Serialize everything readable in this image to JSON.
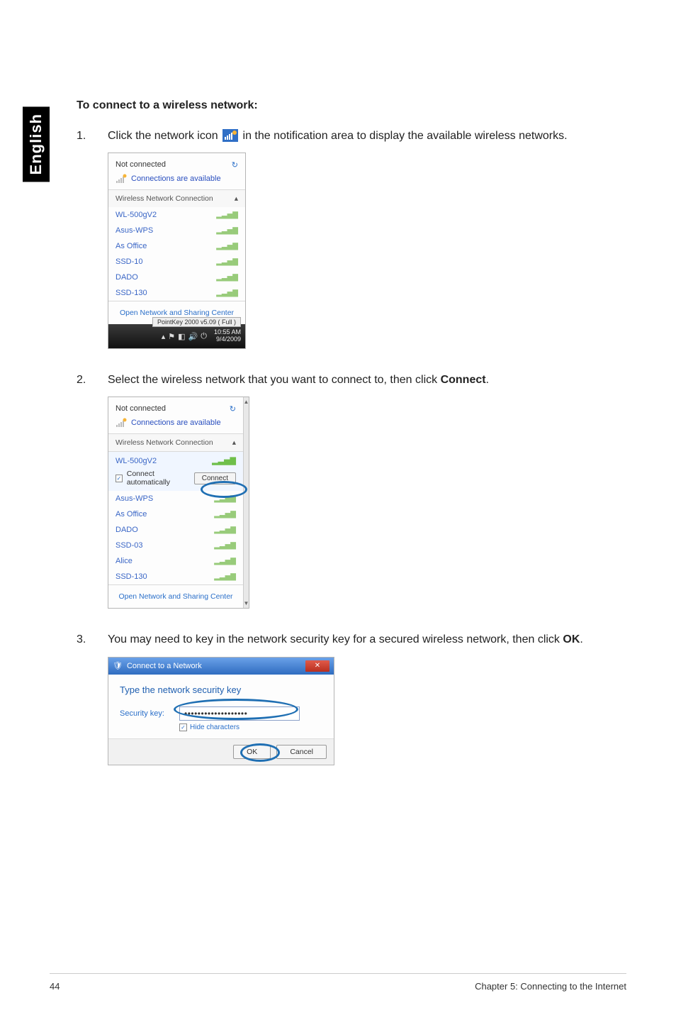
{
  "sidebar_label": "English",
  "heading": "To connect to a wireless network:",
  "steps": {
    "s1": {
      "num": "1.",
      "text_before": "Click the network icon ",
      "text_after": " in the notification area to display the available wireless networks."
    },
    "s2": {
      "num": "2.",
      "text_before": "Select the wireless network that you want to connect to, then click ",
      "bold": "Connect",
      "text_after": "."
    },
    "s3": {
      "num": "3.",
      "text_before": "You may need to key in the network security key for a secured wireless network, then click ",
      "bold": "OK",
      "text_after": "."
    }
  },
  "panel1": {
    "not_connected": "Not connected",
    "conn_available": "Connections are available",
    "section": "Wireless Network Connection",
    "networks": [
      "WL-500gV2",
      "Asus-WPS",
      "As Office",
      "SSD-10",
      "DADO",
      "SSD-130"
    ],
    "footer": "Open Network and Sharing Center",
    "tray_pill": "PointKey 2000 v5.09 ( Full )",
    "time1": "10:55 AM",
    "time2": "9/4/2009"
  },
  "panel2": {
    "not_connected": "Not connected",
    "conn_available": "Connections are available",
    "section": "Wireless Network Connection",
    "selected_ssid": "WL-500gV2",
    "auto_label": "Connect automatically",
    "connect_btn": "Connect",
    "networks": [
      "Asus-WPS",
      "As Office",
      "DADO",
      "SSD-03",
      "Alice",
      "SSD-130"
    ],
    "footer": "Open Network and Sharing Center"
  },
  "panel3": {
    "title": "Connect to a Network",
    "prompt": "Type the network security key",
    "key_label": "Security key:",
    "key_value": "•••••••••••••••••••",
    "hide_chars": "Hide characters",
    "ok": "OK",
    "cancel": "Cancel"
  },
  "footer": {
    "page": "44",
    "chapter": "Chapter 5: Connecting to the Internet"
  }
}
